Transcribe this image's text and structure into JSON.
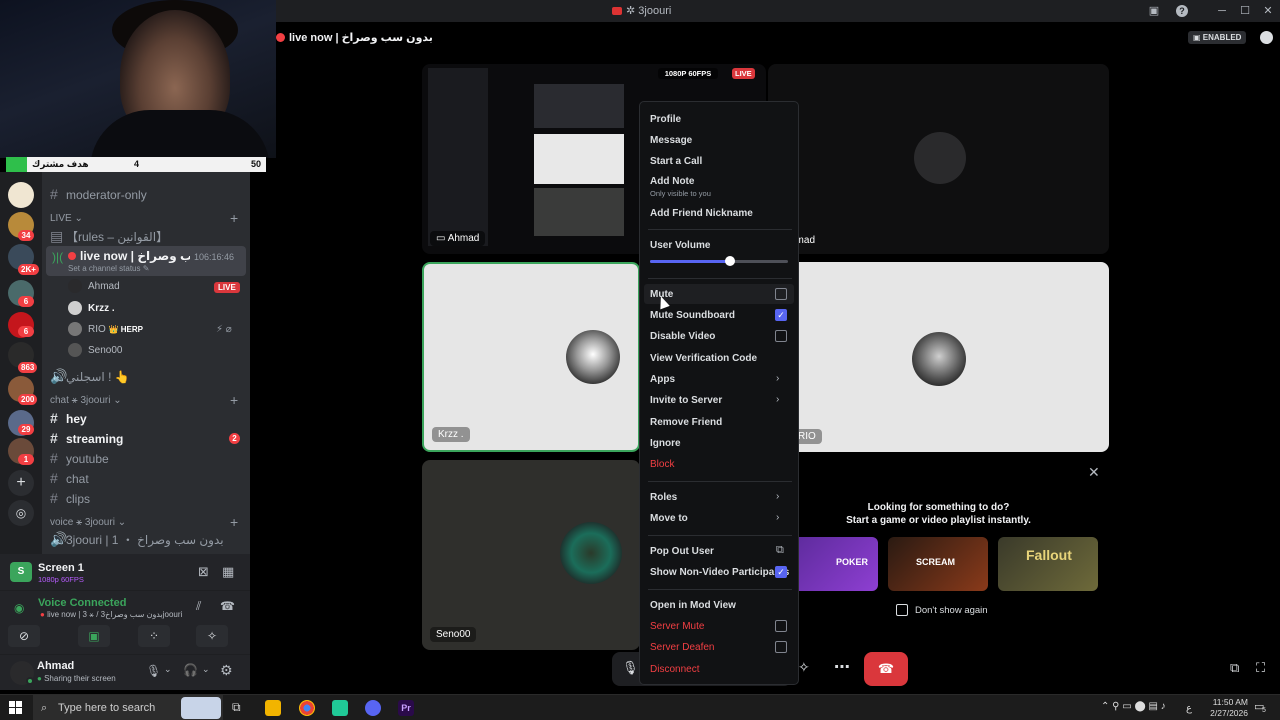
{
  "window": {
    "title": "3joouri"
  },
  "stream_goal": {
    "label": "هدف مشترك",
    "current": "4",
    "target": "50",
    "progress": 0.08
  },
  "rail": {
    "badges": [
      "34",
      "2K+",
      "6",
      "6",
      "863",
      "200",
      "29",
      "1"
    ]
  },
  "channels": {
    "moderator": "moderator-only",
    "live_category": "LIVE",
    "rules": "【rules – القوانين】",
    "live_channel": {
      "name": "live now | بدون سب وصراخ",
      "timer": "106:16:46",
      "status_placeholder": "Set a channel status"
    },
    "voice_users": [
      {
        "name": "Ahmad",
        "badge": "LIVE"
      },
      {
        "name": "Krzz ."
      },
      {
        "name": "RIO",
        "tag": "HERP"
      },
      {
        "name": "Seno00"
      }
    ],
    "stage_ch": "اسجلني ! 👆",
    "chat_category": "chat ⚹ 3joouri",
    "text": [
      {
        "name": "hey",
        "bright": true
      },
      {
        "name": "streaming",
        "bright": true,
        "badge": "2"
      },
      {
        "name": "youtube"
      },
      {
        "name": "chat"
      },
      {
        "name": "clips"
      }
    ],
    "voice_category": "voice ⚹ 3joouri",
    "voice_channel": "3joouri | 1 ・ بدون سب وصراخ"
  },
  "screen_share": {
    "title": "Screen 1",
    "quality": "1080p 60FPS"
  },
  "voice": {
    "status": "Voice Connected",
    "channel": "live now | 3 ⚹ / بدون سب وصراخ3joouri"
  },
  "user": {
    "name": "Ahmad",
    "status": "Sharing their screen"
  },
  "stage": {
    "header": "live now | بدون سب وصراخ",
    "enabled_badge": "ENABLED",
    "stream_quality": "1080P 60FPS",
    "stream_live": "LIVE",
    "tiles": [
      {
        "name": "Ahmad"
      },
      {
        "name": "hmad"
      },
      {
        "name": "Krzz ."
      },
      {
        "name": "RIO"
      },
      {
        "name": "Seno00"
      }
    ],
    "activity": {
      "line1": "Looking for something to do?",
      "line2": "Start a game or video playlist instantly.",
      "dont_show": "Don't show again",
      "games": [
        "POKER",
        "SCREAM",
        "Fallout"
      ]
    }
  },
  "menu": {
    "profile": "Profile",
    "message": "Message",
    "start_call": "Start a Call",
    "add_note": "Add Note",
    "add_note_sub": "Only visible to you",
    "add_nickname": "Add Friend Nickname",
    "user_volume": "User Volume",
    "volume_level": 0.58,
    "mute": "Mute",
    "mute_soundboard": "Mute Soundboard",
    "disable_video": "Disable Video",
    "verification": "View Verification Code",
    "apps": "Apps",
    "invite": "Invite to Server",
    "remove_friend": "Remove Friend",
    "ignore": "Ignore",
    "block": "Block",
    "roles": "Roles",
    "move_to": "Move to",
    "pop_out": "Pop Out User",
    "show_non_video": "Show Non-Video Participants",
    "mod_view": "Open in Mod View",
    "server_mute": "Server Mute",
    "server_deafen": "Server Deafen",
    "disconnect": "Disconnect"
  },
  "taskbar": {
    "search": "Type here to search",
    "time": "11:50 AM",
    "date": "2/27/2026",
    "lang": "ع",
    "notif": "5"
  }
}
